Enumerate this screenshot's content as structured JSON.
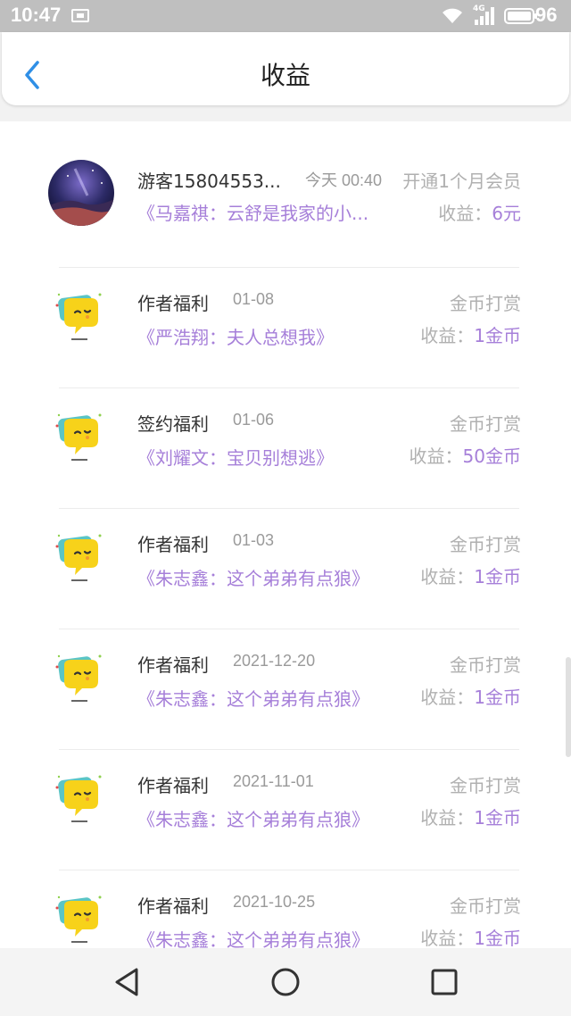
{
  "status_bar": {
    "time": "10:47",
    "network": "4G",
    "battery": "96",
    "icons": [
      "sim-card-icon",
      "wifi-icon",
      "signal-icon",
      "battery-icon"
    ]
  },
  "header": {
    "title": "收益",
    "back_icon": "back-arrow-icon",
    "accent_color": "#2f8fe6"
  },
  "colors": {
    "book_title": "#a67fd9",
    "earnings_value": "#a67fd9",
    "muted": "#b0b0b0"
  },
  "records": [
    {
      "name": "游客15804553...",
      "date": "今天 00:40",
      "type": "开通1个月会员",
      "book": "《马嘉祺：云舒是我家的小...",
      "earn_label": "收益：",
      "earn_value": "6元",
      "avatar": "user-avatar-galaxy"
    },
    {
      "name": "作者福利",
      "date": "01-08",
      "type": "金币打赏",
      "book": "《严浩翔：夫人总想我》",
      "earn_label": "收益：",
      "earn_value": "1金币",
      "avatar": "emoji-chat-icon"
    },
    {
      "name": "签约福利",
      "date": "01-06",
      "type": "金币打赏",
      "book": "《刘耀文：宝贝别想逃》",
      "earn_label": "收益：",
      "earn_value": "50金币",
      "avatar": "emoji-chat-icon"
    },
    {
      "name": "作者福利",
      "date": "01-03",
      "type": "金币打赏",
      "book": "《朱志鑫：这个弟弟有点狼》",
      "earn_label": "收益：",
      "earn_value": "1金币",
      "avatar": "emoji-chat-icon"
    },
    {
      "name": "作者福利",
      "date": "2021-12-20",
      "type": "金币打赏",
      "book": "《朱志鑫：这个弟弟有点狼》",
      "earn_label": "收益：",
      "earn_value": "1金币",
      "avatar": "emoji-chat-icon"
    },
    {
      "name": "作者福利",
      "date": "2021-11-01",
      "type": "金币打赏",
      "book": "《朱志鑫：这个弟弟有点狼》",
      "earn_label": "收益：",
      "earn_value": "1金币",
      "avatar": "emoji-chat-icon"
    },
    {
      "name": "作者福利",
      "date": "2021-10-25",
      "type": "金币打赏",
      "book": "《朱志鑫：这个弟弟有点狼》",
      "earn_label": "收益：",
      "earn_value": "1金币",
      "avatar": "emoji-chat-icon"
    }
  ],
  "nav_bar": {
    "buttons": [
      "back-triangle-icon",
      "home-circle-icon",
      "recents-square-icon"
    ]
  }
}
